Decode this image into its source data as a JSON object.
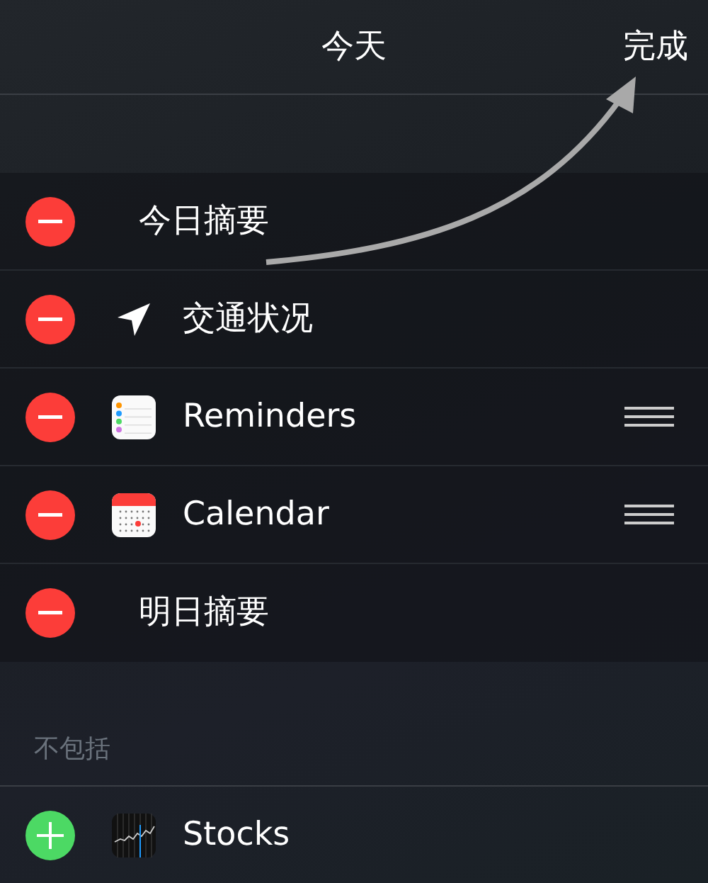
{
  "header": {
    "title": "今天",
    "done_button": "完成"
  },
  "included": [
    {
      "label": "今日摘要",
      "kind": "summary",
      "removable": true,
      "reorderable": false
    },
    {
      "label": "交通状况",
      "kind": "location",
      "removable": true,
      "reorderable": false
    },
    {
      "label": "Reminders",
      "kind": "reminders",
      "removable": true,
      "reorderable": true
    },
    {
      "label": "Calendar",
      "kind": "calendar",
      "removable": true,
      "reorderable": true
    },
    {
      "label": "明日摘要",
      "kind": "summary",
      "removable": true,
      "reorderable": false
    }
  ],
  "excluded_heading": "不包括",
  "excluded": [
    {
      "label": "Stocks",
      "kind": "stocks",
      "removable": false,
      "reorderable": false
    }
  ]
}
